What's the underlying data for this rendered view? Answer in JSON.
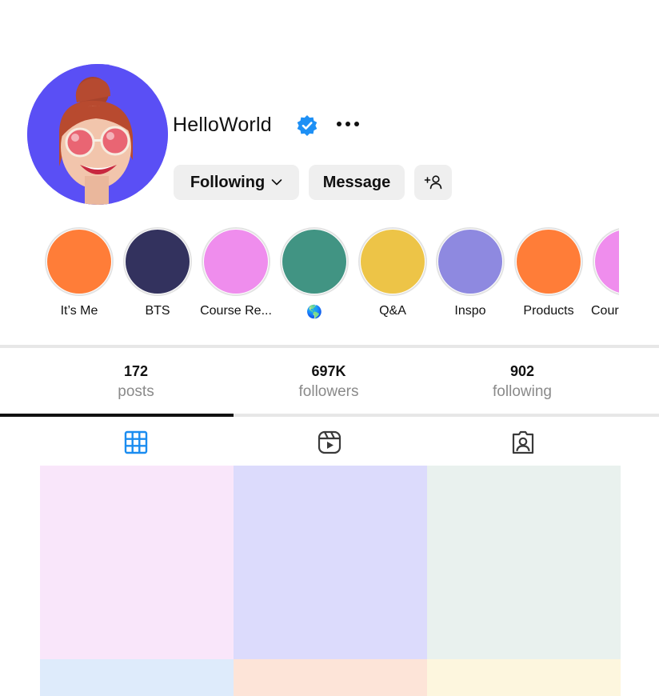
{
  "profile": {
    "username": "HelloWorld",
    "verified": true,
    "avatar_bg": "#5a4ff5"
  },
  "actions": {
    "following_label": "Following",
    "message_label": "Message",
    "add_user_icon": "add-person-icon",
    "more_icon": "more-horizontal-icon"
  },
  "highlights": [
    {
      "label": "It’s Me",
      "color": "#ff7d38"
    },
    {
      "label": "BTS",
      "color": "#33325e"
    },
    {
      "label": "Course Re...",
      "color": "#ef8ded"
    },
    {
      "label": "🌎",
      "color": "#419483"
    },
    {
      "label": "Q&A",
      "color": "#edc447"
    },
    {
      "label": "Inspo",
      "color": "#8e89e0"
    },
    {
      "label": "Products",
      "color": "#ff7d38"
    },
    {
      "label": "Cour",
      "color": "#ef8ded"
    }
  ],
  "stats": {
    "posts": {
      "value": "172",
      "label": "posts"
    },
    "followers": {
      "value": "697K",
      "label": "followers"
    },
    "following": {
      "value": "902",
      "label": "following"
    }
  },
  "tabs": [
    {
      "icon": "grid-icon",
      "active": true,
      "color": "#1a8cf0"
    },
    {
      "icon": "reels-icon",
      "active": false
    },
    {
      "icon": "tagged-icon",
      "active": false
    }
  ],
  "posts_grid": {
    "colors": [
      "#f9e6fa",
      "#dcdbfc",
      "#e9f1ee",
      "#deebfb",
      "#fde4d8",
      "#fdf6de"
    ]
  }
}
